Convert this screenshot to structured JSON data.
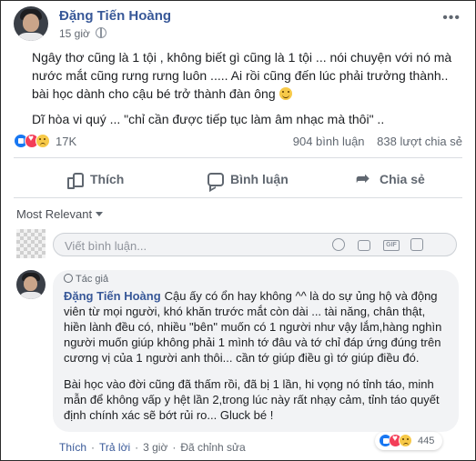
{
  "post": {
    "author": "Đặng Tiến Hoàng",
    "time": "15 giờ",
    "more_icon": "more-horizontal-icon",
    "paragraphs": [
      "Ngây thơ cũng là 1 tội , không biết gì cũng là 1 tội ... nói chuyện với nó mà nước mắt cũng rưng rưng luôn ..... Ai rồi cũng đến lúc phải trưởng thành.. bài học dành cho cậu bé trở thành đàn ông",
      "Dĩ hòa vi quý ... \"chỉ cần được tiếp tục làm âm nhạc mà thôi\" .."
    ],
    "reaction_count": "17K",
    "comments_count": "904 bình luận",
    "shares_count": "838 lượt chia sẻ"
  },
  "actions": {
    "like": "Thích",
    "comment": "Bình luận",
    "share": "Chia sẻ"
  },
  "sort": {
    "label": "Most Relevant"
  },
  "composer": {
    "placeholder": "Viết bình luận..."
  },
  "comment": {
    "badge": "Tác giả",
    "author": "Đặng Tiến Hoàng",
    "text_1": "Cậu ấy có ổn hay không ^^ là do sự ủng hộ và động viên từ mọi người, khó khăn trước mắt còn dài ... tài năng, chân thật, hiền lành đều có, nhiều \"bên\" muốn có 1 người như vậy lắm,hàng nghìn người muốn giúp không phải 1 mình tớ đâu và tớ chỉ đáp ứng đúng trên cương vị của 1 người anh thôi... cần tớ giúp điều gì tớ giúp điều đó.",
    "text_2": "Bài học vào đời cũng đã thấm rồi, đã bị 1 lần, hi vọng nó tỉnh táo, minh mẫn để không vấp y hệt lần 2,trong lúc này rất nhạy cảm, tỉnh táo quyết định chính xác sẽ bớt rủi ro... Gluck bé !",
    "like_label": "Thích",
    "reply_label": "Trả lời",
    "time": "3 giờ",
    "edited": "Đã chỉnh sửa",
    "reaction_count": "445",
    "dot": "·"
  }
}
